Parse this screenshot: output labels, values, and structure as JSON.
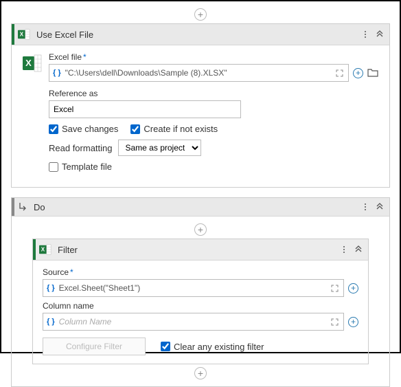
{
  "useExcel": {
    "title": "Use Excel File",
    "excelFileLabel": "Excel file",
    "excelFileValue": "\"C:\\Users\\dell\\Downloads\\Sample (8).XLSX\"",
    "referenceAsLabel": "Reference as",
    "referenceAsValue": "Excel",
    "saveChangesLabel": "Save changes",
    "createIfNotExistsLabel": "Create if not exists",
    "readFormattingLabel": "Read formatting",
    "readFormattingValue": "Same as project",
    "templateFileLabel": "Template file"
  },
  "do": {
    "title": "Do"
  },
  "filter": {
    "title": "Filter",
    "sourceLabel": "Source",
    "sourceValue": "Excel.Sheet(\"Sheet1\")",
    "columnNameLabel": "Column name",
    "columnNamePlaceholder": "Column Name",
    "configureFilterLabel": "Configure Filter",
    "clearExistingLabel": "Clear any existing filter"
  }
}
